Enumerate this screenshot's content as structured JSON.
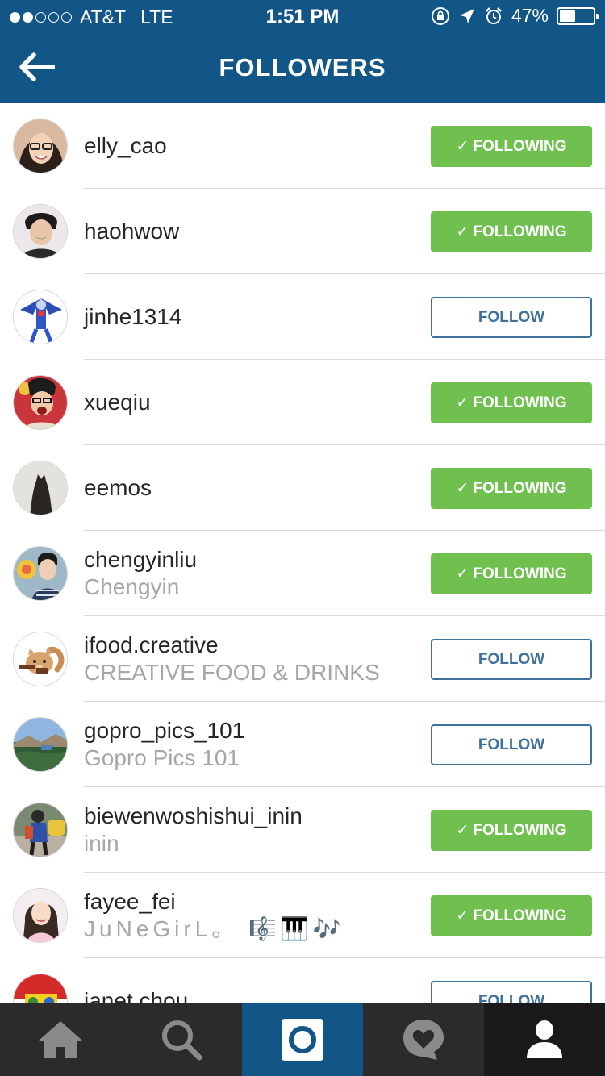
{
  "status_bar": {
    "carrier": "AT&T",
    "network": "LTE",
    "time": "1:51 PM",
    "battery": "47%",
    "battery_level": 0.47,
    "signal_bars": 2,
    "icons": [
      "orientation-lock-icon",
      "location-arrow-icon",
      "alarm-icon",
      "battery-icon"
    ]
  },
  "header": {
    "title": "FOLLOWERS",
    "back_icon": "back-arrow-icon"
  },
  "colors": {
    "header_bg": "#125688",
    "following_green": "#70c050",
    "follow_blue": "#3f729b",
    "tabbar_bg": "#2b2b2b",
    "secondary_text": "#a6a6a6"
  },
  "followers": [
    {
      "username": "elly_cao",
      "full_name": "",
      "status": "following",
      "button_label": "FOLLOWING",
      "check": "✓"
    },
    {
      "username": "haohwow",
      "full_name": "",
      "status": "following",
      "button_label": "FOLLOWING",
      "check": "✓"
    },
    {
      "username": "jinhe1314",
      "full_name": "",
      "status": "follow",
      "button_label": "FOLLOW",
      "check": ""
    },
    {
      "username": "xueqiu",
      "full_name": "",
      "status": "following",
      "button_label": "FOLLOWING",
      "check": "✓"
    },
    {
      "username": "eemos",
      "full_name": "",
      "status": "following",
      "button_label": "FOLLOWING",
      "check": "✓"
    },
    {
      "username": "chengyinliu",
      "full_name": "Chengyin",
      "status": "following",
      "button_label": "FOLLOWING",
      "check": "✓"
    },
    {
      "username": "ifood.creative",
      "full_name": "CREATIVE FOOD & DRINKS",
      "status": "follow",
      "button_label": "FOLLOW",
      "check": ""
    },
    {
      "username": "gopro_pics_101",
      "full_name": "Gopro Pics 101",
      "status": "follow",
      "button_label": "FOLLOW",
      "check": ""
    },
    {
      "username": "biewenwoshishui_inin",
      "full_name": "inin",
      "status": "following",
      "button_label": "FOLLOWING",
      "check": "✓"
    },
    {
      "username": "fayee_fei",
      "full_name": "JuNeGirL。     🎼🎹🎶",
      "status": "following",
      "button_label": "FOLLOWING",
      "check": "✓"
    },
    {
      "username": "janet.chou",
      "full_name": "",
      "status": "follow",
      "button_label": "FOLLOW",
      "check": ""
    }
  ],
  "tab_bar": {
    "tabs": [
      {
        "icon": "home-icon",
        "active": false
      },
      {
        "icon": "search-icon",
        "active": false
      },
      {
        "icon": "camera-icon",
        "active": true
      },
      {
        "icon": "heart-bubble-icon",
        "active": false
      },
      {
        "icon": "profile-icon",
        "active": false
      }
    ]
  }
}
